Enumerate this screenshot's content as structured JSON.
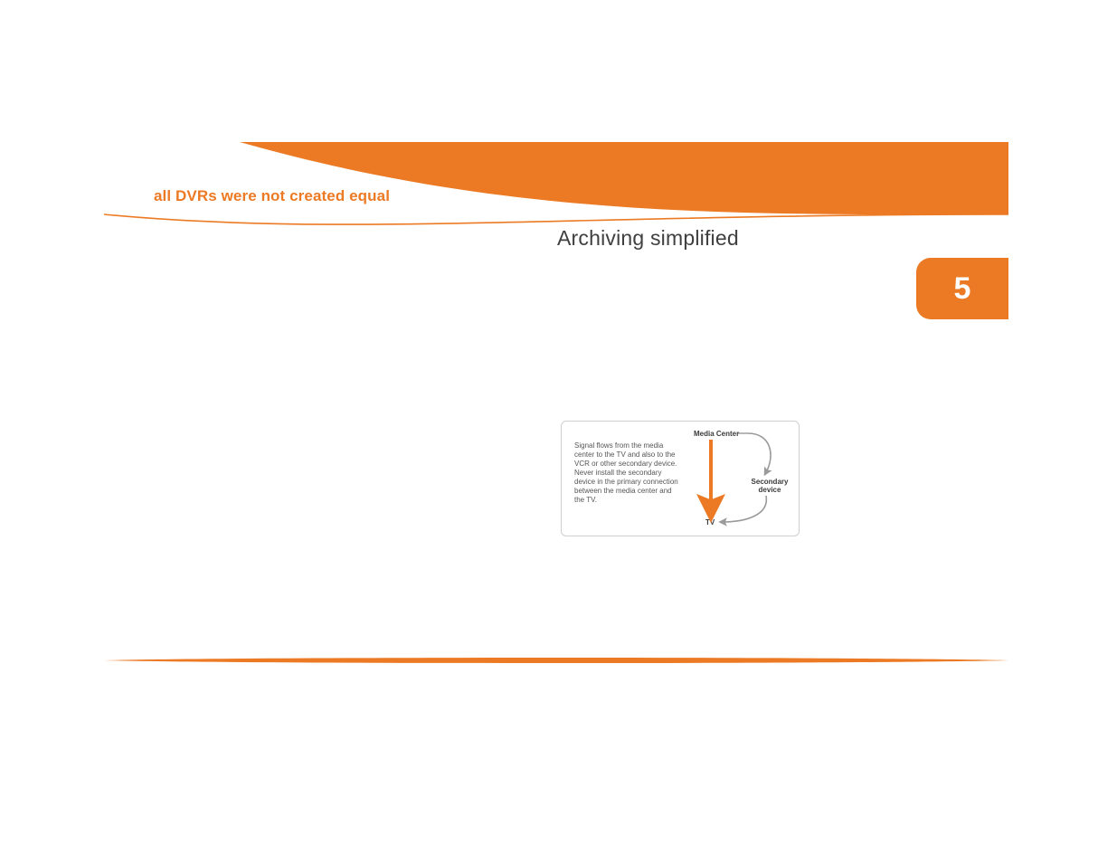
{
  "header": {
    "tagline": "all DVRs were not created equal"
  },
  "section": {
    "title": "Archiving simplified",
    "page_number": "5"
  },
  "diagram": {
    "description": "Signal flows from the media center to the TV and also to the VCR or other secondary device. Never install the secondary device in the primary connection between the media center and the TV.",
    "nodes": {
      "media_center": "Media Center",
      "secondary": "Secondary device",
      "tv": "TV"
    }
  },
  "colors": {
    "accent": "#ec7a24",
    "text": "#3f3f3f",
    "border": "#cfcfcf",
    "arrow_gray": "#9a9a9a"
  }
}
